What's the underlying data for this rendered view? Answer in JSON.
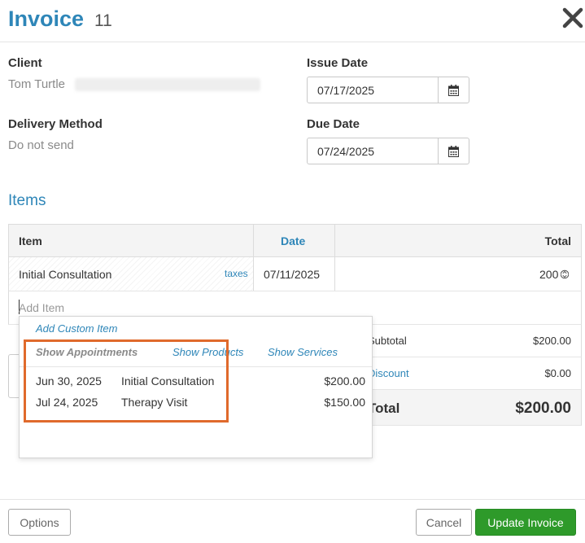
{
  "header": {
    "title": "Invoice",
    "number": "11"
  },
  "client": {
    "label": "Client",
    "name": "Tom Turtle"
  },
  "delivery": {
    "label": "Delivery Method",
    "value": "Do not send"
  },
  "issue_date": {
    "label": "Issue Date",
    "value": "07/17/2025"
  },
  "due_date": {
    "label": "Due Date",
    "value": "07/24/2025"
  },
  "items": {
    "title": "Items",
    "columns": {
      "item": "Item",
      "date": "Date",
      "total": "Total"
    },
    "rows": [
      {
        "name": "Initial Consultation",
        "taxes": "taxes",
        "date": "07/11/2025",
        "total": "200"
      }
    ],
    "add_placeholder": "Add Item"
  },
  "totals": {
    "subtotal_label": "Subtotal",
    "subtotal_value": "$200.00",
    "discount_label": "Discount",
    "discount_value": "$0.00",
    "total_label": "Total",
    "total_value": "$200.00"
  },
  "dropdown": {
    "add_custom": "Add Custom Item",
    "tabs": {
      "appointments": "Show Appointments",
      "products": "Show Products",
      "services": "Show Services"
    },
    "appointments": [
      {
        "date": "Jun 30, 2025",
        "name": "Initial Consultation",
        "price": "$200.00"
      },
      {
        "date": "Jul 24, 2025",
        "name": "Therapy Visit",
        "price": "$150.00"
      }
    ]
  },
  "footer": {
    "options": "Options",
    "cancel": "Cancel",
    "update": "Update Invoice"
  },
  "colors": {
    "accent": "#2e86b8",
    "primary_button": "#2e9a2a",
    "highlight": "#e06a2c"
  }
}
